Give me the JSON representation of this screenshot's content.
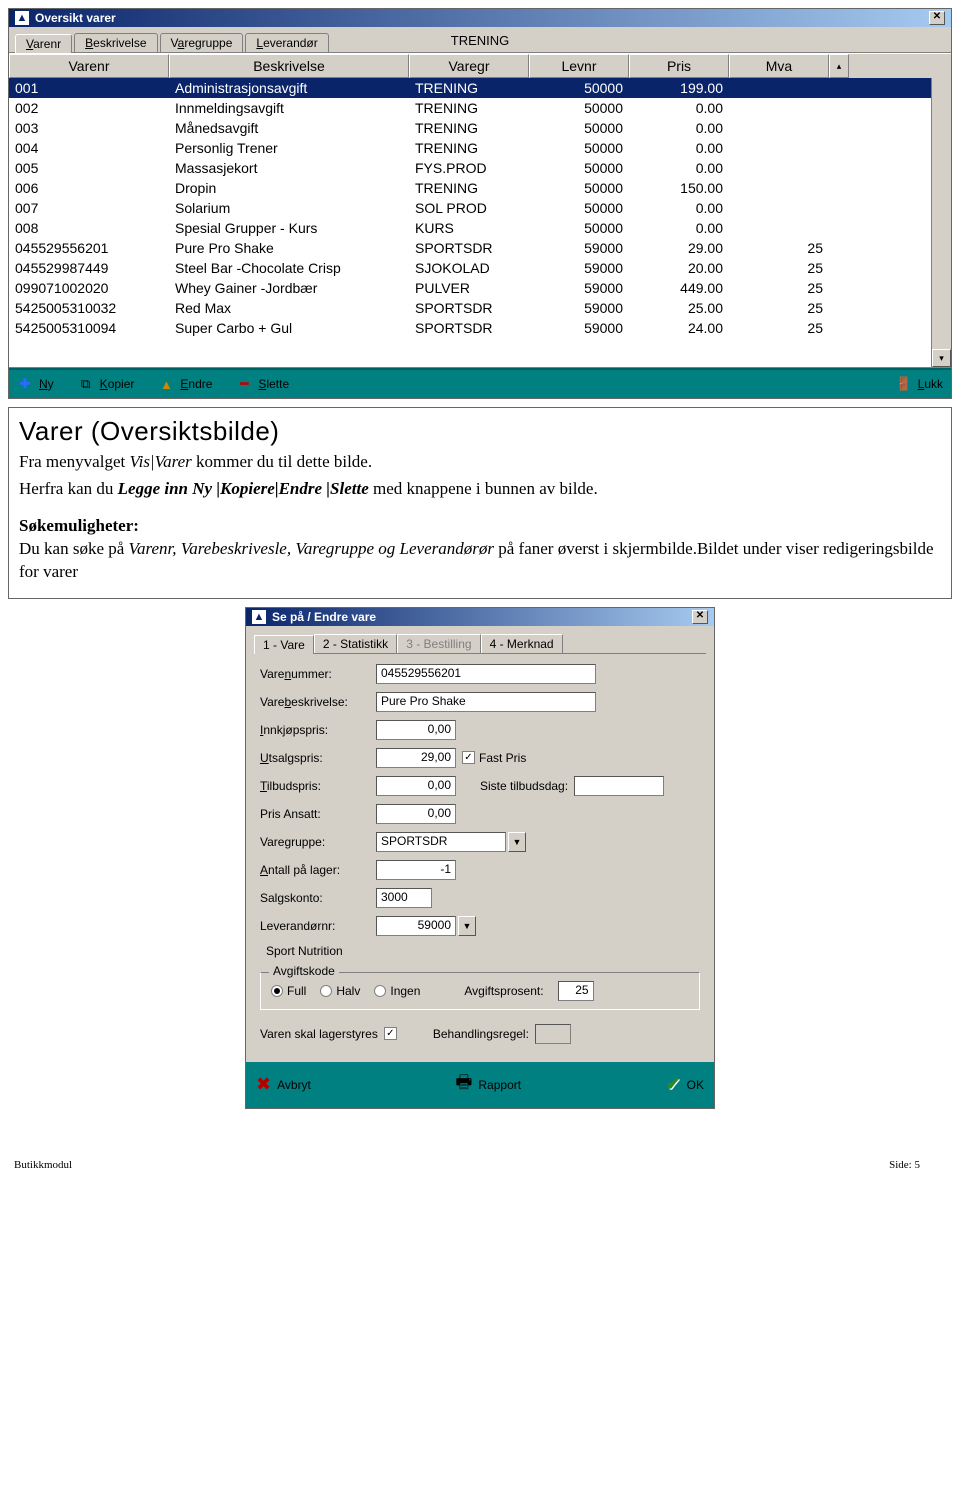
{
  "mainWindow": {
    "title": "Oversikt varer",
    "tabs": [
      "Varenr",
      "Beskrivelse",
      "Varegruppe",
      "Leverandør"
    ],
    "centerLabel": "TRENING",
    "columns": [
      "Varenr",
      "Beskrivelse",
      "Varegr",
      "Levnr",
      "Pris",
      "Mva"
    ],
    "rows": [
      {
        "varenr": "001",
        "besk": "Administrasjonsavgift",
        "gr": "TRENING",
        "lev": "50000",
        "pris": "199.00",
        "mva": ""
      },
      {
        "varenr": "002",
        "besk": "Innmeldingsavgift",
        "gr": "TRENING",
        "lev": "50000",
        "pris": "0.00",
        "mva": ""
      },
      {
        "varenr": "003",
        "besk": "Månedsavgift",
        "gr": "TRENING",
        "lev": "50000",
        "pris": "0.00",
        "mva": ""
      },
      {
        "varenr": "004",
        "besk": "Personlig Trener",
        "gr": "TRENING",
        "lev": "50000",
        "pris": "0.00",
        "mva": ""
      },
      {
        "varenr": "005",
        "besk": "Massasjekort",
        "gr": "FYS.PROD",
        "lev": "50000",
        "pris": "0.00",
        "mva": ""
      },
      {
        "varenr": "006",
        "besk": "Dropin",
        "gr": "TRENING",
        "lev": "50000",
        "pris": "150.00",
        "mva": ""
      },
      {
        "varenr": "007",
        "besk": "Solarium",
        "gr": "SOL PROD",
        "lev": "50000",
        "pris": "0.00",
        "mva": ""
      },
      {
        "varenr": "008",
        "besk": "Spesial Grupper - Kurs",
        "gr": "KURS",
        "lev": "50000",
        "pris": "0.00",
        "mva": ""
      },
      {
        "varenr": "045529556201",
        "besk": "Pure Pro Shake",
        "gr": "SPORTSDR",
        "lev": "59000",
        "pris": "29.00",
        "mva": "25"
      },
      {
        "varenr": "045529987449",
        "besk": "Steel Bar -Chocolate Crisp",
        "gr": "SJOKOLAD",
        "lev": "59000",
        "pris": "20.00",
        "mva": "25"
      },
      {
        "varenr": "099071002020",
        "besk": "Whey Gainer -Jordbær",
        "gr": "PULVER",
        "lev": "59000",
        "pris": "449.00",
        "mva": "25"
      },
      {
        "varenr": "5425005310032",
        "besk": "Red Max",
        "gr": "SPORTSDR",
        "lev": "59000",
        "pris": "25.00",
        "mva": "25"
      },
      {
        "varenr": "5425005310094",
        "besk": "Super Carbo + Gul",
        "gr": "SPORTSDR",
        "lev": "59000",
        "pris": "24.00",
        "mva": "25"
      }
    ],
    "toolbar": {
      "ny": "Ny",
      "kopier": "Kopier",
      "endre": "Endre",
      "slette": "Slette",
      "lukk": "Lukk"
    }
  },
  "doc": {
    "title": "Varer (Oversiktsbilde)",
    "p1a": "Fra menyvalget ",
    "p1b": "Vis|Varer",
    "p1c": " kommer du til dette bilde.",
    "p2a": "Herfra kan du ",
    "p2b": "Legge inn Ny |Kopiere|Endre |Slette",
    "p2c": "  med knappene i bunnen av bilde.",
    "sect": "Søkemuligheter:",
    "p3a": "Du kan søke på ",
    "p3b": "Varenr, Varebeskrivesle, Varegruppe og Leverandørør",
    "p3c": "  på faner øverst i skjermbilde.Bildet under viser redigeringsbilde for varer"
  },
  "dialog": {
    "title": "Se på / Endre vare",
    "tabs": {
      "t1": "1 - Vare",
      "t2": "2 - Statistikk",
      "t3": "3 - Bestilling",
      "t4": "4 - Merknad"
    },
    "labels": {
      "varenr": "Varenummer:",
      "besk": "Varebeskrivelse:",
      "innkjop": "Innkjøpspris:",
      "utsalg": "Utsalgspris:",
      "fastpris": "Fast Pris",
      "tilbud": "Tilbudspris:",
      "sistetilbud": "Siste tilbudsdag:",
      "prisansatt": "Pris Ansatt:",
      "varegruppe": "Varegruppe:",
      "antall": "Antall på lager:",
      "salgskonto": "Salgskonto:",
      "levnr": "Leverandørnr:",
      "levname": "Sport Nutrition",
      "avgiftskode": "Avgiftskode",
      "full": "Full",
      "halv": "Halv",
      "ingen": "Ingen",
      "avgiftsprosent": "Avgiftsprosent:",
      "lagerstyres": "Varen skal lagerstyres",
      "behandling": "Behandlingsregel:"
    },
    "values": {
      "varenr": "045529556201",
      "besk": "Pure Pro Shake",
      "innkjop": "0,00",
      "utsalg": "29,00",
      "tilbud": "0,00",
      "prisansatt": "0,00",
      "varegruppe": "SPORTSDR",
      "antall": "-1",
      "salgskonto": "3000",
      "levnr": "59000",
      "avgiftsprosent": "25",
      "fastpris_checked": true,
      "lagerstyres_checked": true
    },
    "footer": {
      "avbryt": "Avbryt",
      "rapport": "Rapport",
      "ok": "OK"
    }
  },
  "pageFooter": {
    "left": "Butikkmodul",
    "right": "Side:  5"
  }
}
